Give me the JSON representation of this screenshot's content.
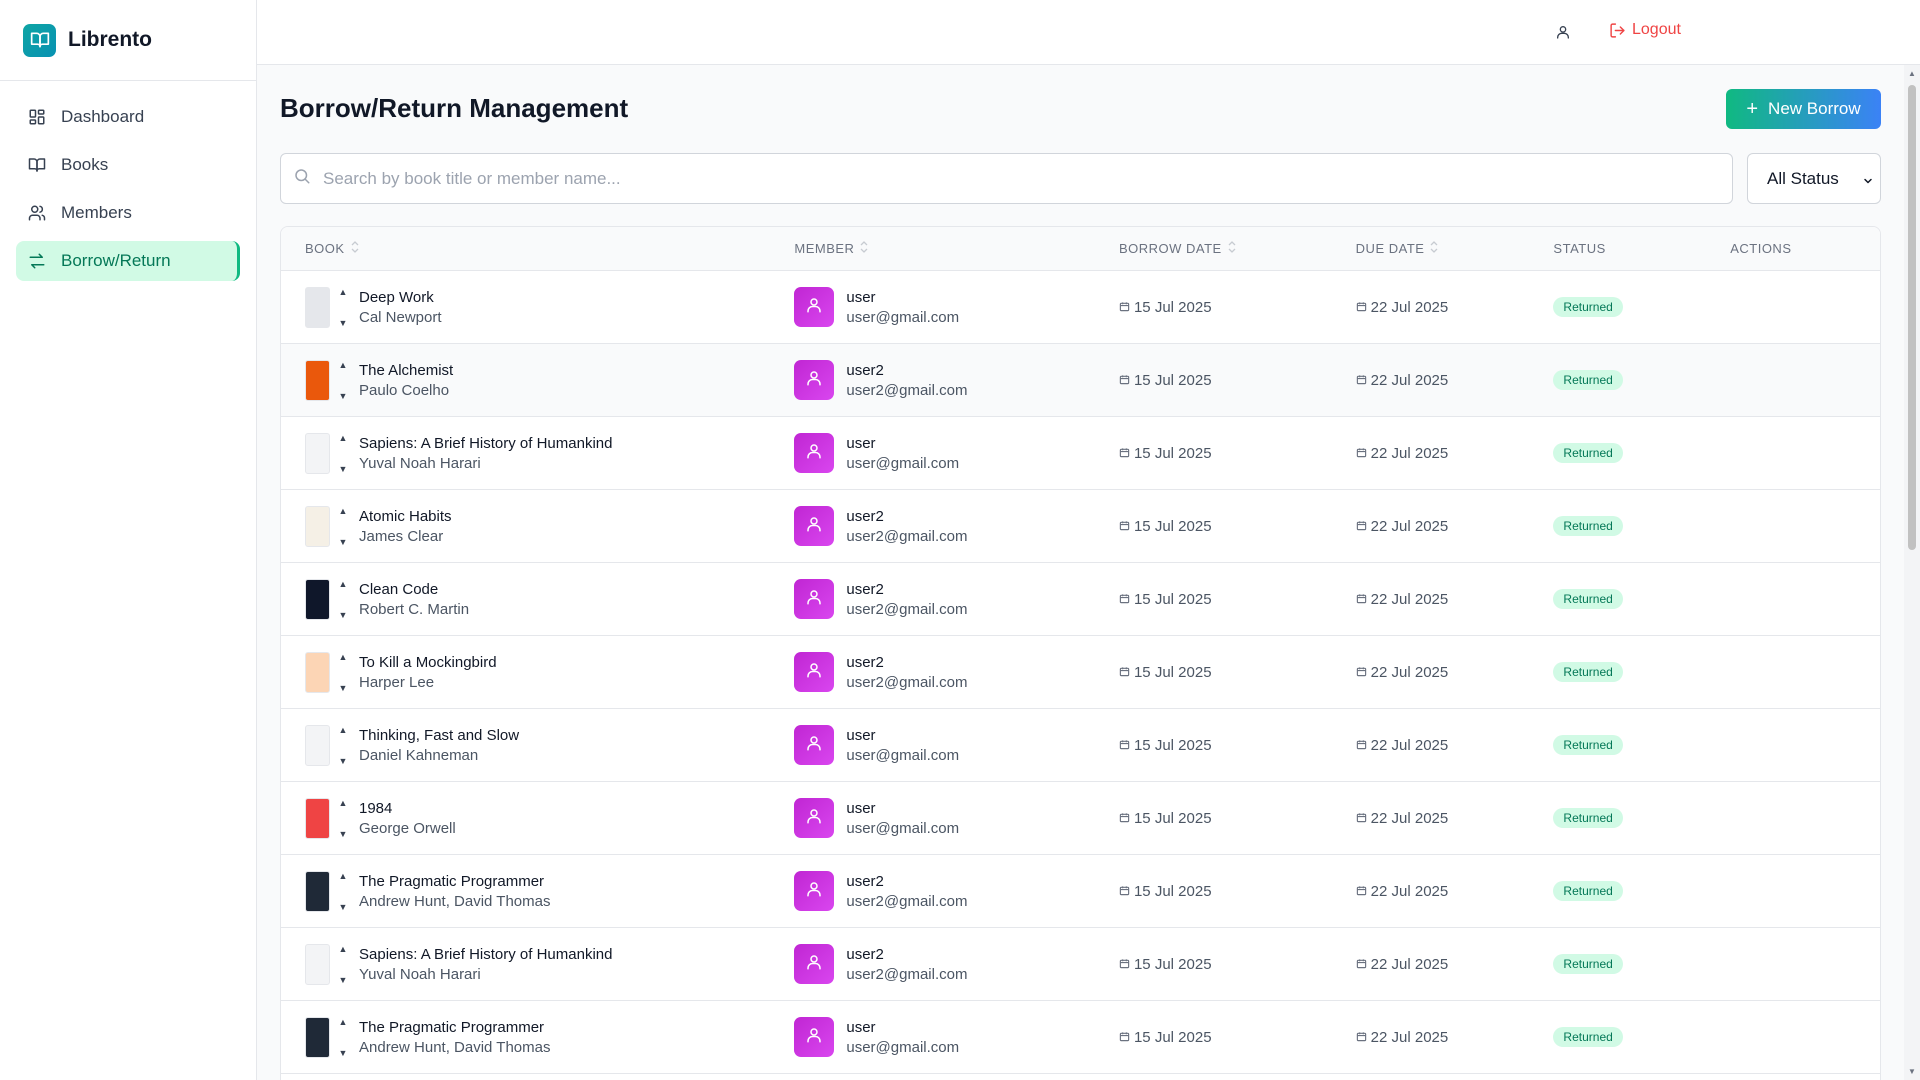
{
  "app": {
    "name": "Librento"
  },
  "sidebar": {
    "items": [
      {
        "label": "Dashboard",
        "icon": "dashboard-icon"
      },
      {
        "label": "Books",
        "icon": "book-icon"
      },
      {
        "label": "Members",
        "icon": "members-icon"
      },
      {
        "label": "Borrow/Return",
        "icon": "swap-icon",
        "active": true
      }
    ]
  },
  "topbar": {
    "logout_label": "Logout"
  },
  "page": {
    "title": "Borrow/Return Management",
    "new_button_label": "New Borrow",
    "search_placeholder": "Search by book title or member name...",
    "status_filter": "All Status"
  },
  "table": {
    "headers": {
      "book": "BOOK",
      "member": "MEMBER",
      "borrow_date": "BORROW DATE",
      "due_date": "DUE DATE",
      "status": "STATUS",
      "actions": "ACTIONS"
    },
    "rows": [
      {
        "title": "Deep Work",
        "author": "Cal Newport",
        "member": "user",
        "email": "user@gmail.com",
        "borrow": "15 Jul 2025",
        "due": "22 Jul 2025",
        "status": "Returned",
        "cover": "#e5e7eb"
      },
      {
        "title": "The Alchemist",
        "author": "Paulo Coelho",
        "member": "user2",
        "email": "user2@gmail.com",
        "borrow": "15 Jul 2025",
        "due": "22 Jul 2025",
        "status": "Returned",
        "cover": "#ea580c"
      },
      {
        "title": "Sapiens: A Brief History of Humankind",
        "author": "Yuval Noah Harari",
        "member": "user",
        "email": "user@gmail.com",
        "borrow": "15 Jul 2025",
        "due": "22 Jul 2025",
        "status": "Returned",
        "cover": "#f3f4f6"
      },
      {
        "title": "Atomic Habits",
        "author": "James Clear",
        "member": "user2",
        "email": "user2@gmail.com",
        "borrow": "15 Jul 2025",
        "due": "22 Jul 2025",
        "status": "Returned",
        "cover": "#f5f0e6"
      },
      {
        "title": "Clean Code",
        "author": "Robert C. Martin",
        "member": "user2",
        "email": "user2@gmail.com",
        "borrow": "15 Jul 2025",
        "due": "22 Jul 2025",
        "status": "Returned",
        "cover": "#0f172a"
      },
      {
        "title": "To Kill a Mockingbird",
        "author": "Harper Lee",
        "member": "user2",
        "email": "user2@gmail.com",
        "borrow": "15 Jul 2025",
        "due": "22 Jul 2025",
        "status": "Returned",
        "cover": "#fcd5b5"
      },
      {
        "title": "Thinking, Fast and Slow",
        "author": "Daniel Kahneman",
        "member": "user",
        "email": "user@gmail.com",
        "borrow": "15 Jul 2025",
        "due": "22 Jul 2025",
        "status": "Returned",
        "cover": "#f3f4f6"
      },
      {
        "title": "1984",
        "author": "George Orwell",
        "member": "user",
        "email": "user@gmail.com",
        "borrow": "15 Jul 2025",
        "due": "22 Jul 2025",
        "status": "Returned",
        "cover": "#ef4444"
      },
      {
        "title": "The Pragmatic Programmer",
        "author": "Andrew Hunt, David Thomas",
        "member": "user2",
        "email": "user2@gmail.com",
        "borrow": "15 Jul 2025",
        "due": "22 Jul 2025",
        "status": "Returned",
        "cover": "#1f2937"
      },
      {
        "title": "Sapiens: A Brief History of Humankind",
        "author": "Yuval Noah Harari",
        "member": "user2",
        "email": "user2@gmail.com",
        "borrow": "15 Jul 2025",
        "due": "22 Jul 2025",
        "status": "Returned",
        "cover": "#f3f4f6"
      },
      {
        "title": "The Pragmatic Programmer",
        "author": "Andrew Hunt, David Thomas",
        "member": "user",
        "email": "user@gmail.com",
        "borrow": "15 Jul 2025",
        "due": "22 Jul 2025",
        "status": "Returned",
        "cover": "#1f2937"
      }
    ]
  }
}
